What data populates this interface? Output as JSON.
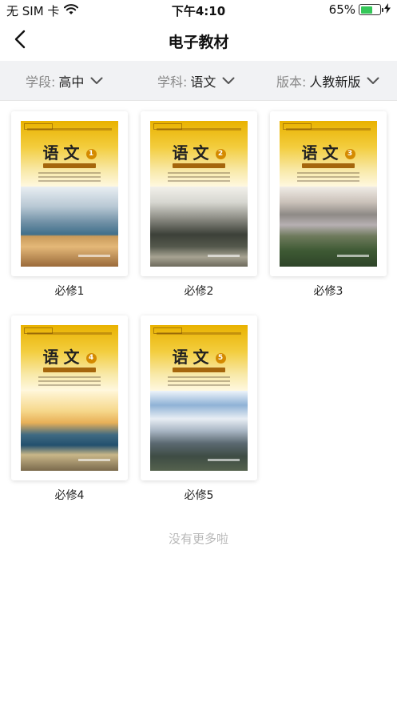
{
  "status": {
    "carrier": "无 SIM 卡",
    "time": "下午4:10",
    "battery_percent_label": "65%",
    "battery_level": 0.65,
    "wifi_icon": "wifi-icon",
    "charging_icon": "charging-bolt-icon"
  },
  "nav": {
    "title": "电子教材",
    "back_icon": "chevron-left-icon"
  },
  "filters": [
    {
      "label": "学段:",
      "value": "高中"
    },
    {
      "label": "学科:",
      "value": "语文"
    },
    {
      "label": "版本:",
      "value": "人教新版"
    }
  ],
  "books": [
    {
      "cover_title": "语文",
      "volume": "1",
      "name": "必修1"
    },
    {
      "cover_title": "语文",
      "volume": "2",
      "name": "必修2"
    },
    {
      "cover_title": "语文",
      "volume": "3",
      "name": "必修3"
    },
    {
      "cover_title": "语文",
      "volume": "4",
      "name": "必修4"
    },
    {
      "cover_title": "语文",
      "volume": "5",
      "name": "必修5"
    }
  ],
  "footer": {
    "no_more": "没有更多啦"
  },
  "colors": {
    "filter_bg": "#f1f2f4",
    "cover_yellow": "#f3cd3e",
    "footer_text": "#b9b9b9",
    "battery_green": "#35c759"
  }
}
